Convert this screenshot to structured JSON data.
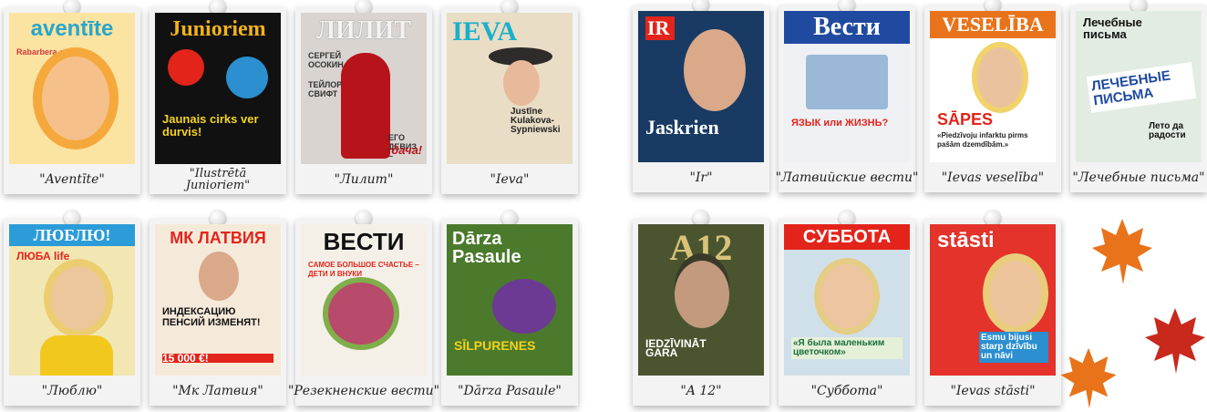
{
  "colors": {
    "card": "#f3f3f3",
    "caption": "#222222",
    "leaf_orange": "#e8731b",
    "leaf_red": "#c9281c"
  },
  "magazines": [
    {
      "caption": "\"Aventīte\"",
      "title": "aventīte",
      "title_color": "#2aa6c9",
      "bg": "#fbe3a2",
      "icon": "cartoon-girl-icon"
    },
    {
      "caption": "\"Ilustrētā Junioriem\"",
      "title": "Junioriem",
      "title_color": "#f2b21b",
      "bg": "#111111",
      "icon": "circus-icon"
    },
    {
      "caption": "\"Лилит\"",
      "title": "ЛИЛИТ",
      "title_color": "#f4f4f4",
      "bg": "#b7131a",
      "icon": "woman-red-suit-icon"
    },
    {
      "caption": "\"Ieva\"",
      "title": "IEVA",
      "title_color": "#1ab0c9",
      "bg": "#e9ddc6",
      "icon": "woman-hat-icon"
    },
    {
      "caption": "\"Ir\"",
      "title": "IR",
      "title_color": "#ffffff",
      "bg": "#183a63",
      "icon": "man-portrait-icon"
    },
    {
      "caption": "\"Латвийские вести\"",
      "title": "Вести",
      "title_color": "#ffffff",
      "bg": "#1f4aa0",
      "icon": "newspaper-collage-icon"
    },
    {
      "caption": "\"Ievas veselība\"",
      "title": "VESELĪBA",
      "title_color": "#ffffff",
      "bg": "#ffffff",
      "icon": "doctor-woman-icon"
    },
    {
      "caption": "\"Лечебные письма\"",
      "title": "Лечебные письма",
      "title_color": "#111111",
      "bg": "#e3ece3",
      "icon": "newspaper-icon"
    },
    {
      "caption": "\"Люблю\"",
      "title": "ЛЮБЛЮ!",
      "title_color": "#ffffff",
      "bg": "#2b9cd8",
      "icon": "blonde-woman-icon"
    },
    {
      "caption": "\"Мк Латвия\"",
      "title": "МК ЛАТВИЯ",
      "title_color": "#e3241b",
      "bg": "#f5e9d9",
      "icon": "elderly-woman-icon"
    },
    {
      "caption": "\"Резекненские вести\"",
      "title": "ВЕСТИ",
      "title_color": "#111111",
      "bg": "#f4f0e8",
      "icon": "flowers-icon"
    },
    {
      "caption": "\"Dārza Pasaule\"",
      "title": "Dārza Pasaule",
      "title_color": "#ffffff",
      "bg": "#4b7a2c",
      "icon": "flowers-purple-icon"
    },
    {
      "caption": "\"A 12\"",
      "title": "A12",
      "title_color": "#d9c27a",
      "bg": "#4a5530",
      "icon": "soldier-icon"
    },
    {
      "caption": "\"Суббота\"",
      "title": "СУББОТА",
      "title_color": "#ffffff",
      "bg": "#cfe0ea",
      "icon": "woman-smile-icon"
    },
    {
      "caption": "\"Ievas stāsti\"",
      "title": "stāsti",
      "title_color": "#ffffff",
      "bg": "#e3332a",
      "icon": "woman-blonde-icon"
    }
  ],
  "cover_text": {
    "aventite": [
      "Rabarbera sarga"
    ],
    "junioriem": [
      "Jaunais cirks ver durvis!"
    ],
    "lilit": [
      "СЕРГЕЙ ОСОКИН",
      "ТЕЙЛОР СВИФТ",
      "ЕГО ДЕВИЗ –",
      "удача!"
    ],
    "ieva": [
      "Justīne Kulakova-Sypniewski"
    ],
    "ir": [
      "Jaskrien"
    ],
    "vesti": [
      "ЯЗЫК или ЖИЗНЬ?"
    ],
    "veseliba": [
      "SĀPES",
      "«Piedzīvoju infarktu pirms pašām dzemdībām.»"
    ],
    "pisma": [
      "ЛЕЧЕБНЫЕ ПИСЬМА",
      "Лето да радости"
    ],
    "lublu": [
      "ЛЮБА life"
    ],
    "mk": [
      "ИНДЕКСАЦИЮ ПЕНСИЙ ИЗМЕНЯТ!",
      "15 000 €!"
    ],
    "rezekne": [
      "САМОЕ БОЛЬШОЕ СЧАСТЬЕ – ДЕТИ И ВНУКИ"
    ],
    "darza": [
      "SĪLPURENES"
    ],
    "a12": [
      "IEDZĪVINĀT GARA"
    ],
    "subbota": [
      "«Я была маленьким цветочком»"
    ],
    "stasti": [
      "Esmu bijusi starp dzīvību un nāvi"
    ]
  }
}
